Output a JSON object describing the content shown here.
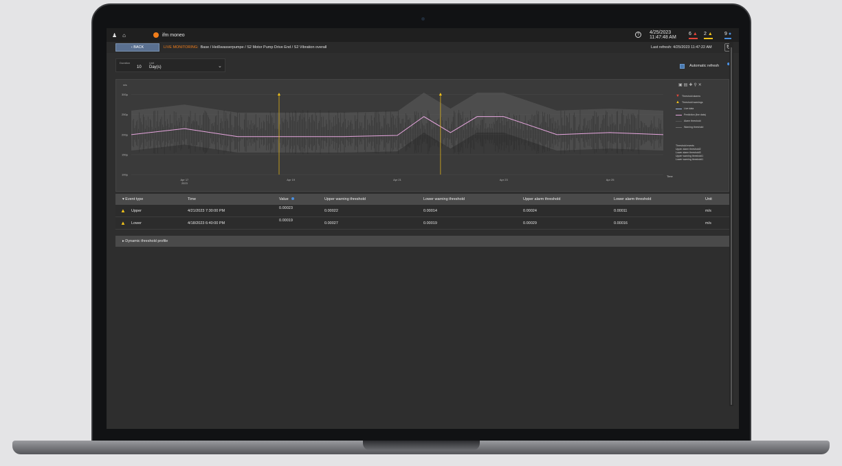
{
  "app": {
    "name": "ifm moneo"
  },
  "header": {
    "date": "4/25/2023",
    "time": "11:47:48 AM",
    "alarms_count": "6",
    "warnings_count": "2",
    "infos_count": "9"
  },
  "breadcrumb": {
    "back_label": "BACK",
    "live_label": "LIVE MONITORING:",
    "path": "Base / Heißwasserpumpe / S2 Motor Pump Drive End / S2 Vibration overall",
    "last_refresh": "Last refresh: 4/25/2023 11:47:22 AM"
  },
  "controls": {
    "duration_label": "Duration",
    "duration_value": "10",
    "unit_label": "Unit",
    "unit_value": "Day(s)",
    "auto_refresh_label": "Automatic refresh",
    "auto_refresh_checked": true
  },
  "chart_data": {
    "type": "line",
    "ylabel": "m/s",
    "xlabel": "Time",
    "ytick_labels": [
      "300µ",
      "250µ",
      "200µ",
      "150µ",
      "100µ"
    ],
    "y_ticks": [
      0.0003,
      0.00025,
      0.0002,
      0.00015,
      0.0001
    ],
    "ylim": [
      0.0001,
      0.00032
    ],
    "xtick_labels": [
      "Apr 17\n2023",
      "Apr 19",
      "Apr 21",
      "Apr 23",
      "Apr 25"
    ],
    "x_ticks": [
      "2023-04-17",
      "2023-04-19",
      "2023-04-21",
      "2023-04-23",
      "2023-04-25"
    ],
    "xlim": [
      "2023-04-16",
      "2023-04-26"
    ],
    "series": [
      {
        "name": "Live data",
        "color": "#9fb9e6"
      },
      {
        "name": "Prediction (live data)",
        "color": "#e8a7e0",
        "x": [
          "2023-04-16",
          "2023-04-17",
          "2023-04-18",
          "2023-04-19",
          "2023-04-20",
          "2023-04-21",
          "2023-04-21T12:00",
          "2023-04-22",
          "2023-04-22T12:00",
          "2023-04-23",
          "2023-04-24",
          "2023-04-25",
          "2023-04-26"
        ],
        "y": [
          0.0002,
          0.000215,
          0.000195,
          0.000195,
          0.000195,
          0.000198,
          0.000245,
          0.000205,
          0.000245,
          0.000245,
          0.0002,
          0.000205,
          0.0002
        ]
      },
      {
        "name": "Alarm threshold",
        "color": "#555555"
      },
      {
        "name": "Warning threshold",
        "color": "#6c6c6c"
      }
    ],
    "events": [
      {
        "type": "Threshold warnings",
        "date": "2023-04-18T18:40:00",
        "value": 0.00019
      },
      {
        "type": "Threshold warnings",
        "date": "2023-04-21T19:30:00",
        "value": 0.00023
      }
    ],
    "legend": {
      "position": "right",
      "items": [
        "Threshold alarms",
        "Threshold warnings",
        "Live data",
        "Prediction (live data)",
        "Alarm threshold",
        "Warning threshold"
      ],
      "threshold_events_title": "Threshold events",
      "threshold_events": [
        "Upper alarm threshold2",
        "Lower alarm threshold3",
        "Upper warning threshold1",
        "Lower warning threshold1"
      ]
    }
  },
  "table": {
    "headers": [
      "Event type",
      "Time",
      "Value",
      "Upper warning threshold",
      "Lower warning threshold",
      "Upper alarm threshold",
      "Lower alarm threshold",
      "Unit"
    ],
    "rows": [
      [
        "Upper",
        "4/21/2023 7:30:00 PM",
        "0.00023",
        "0.00022",
        "0.00014",
        "0.00024",
        "0.00011",
        "m/s"
      ],
      [
        "Lower",
        "4/18/2023 6:40:00 PM",
        "0.00019",
        "0.00027",
        "0.00019",
        "0.00029",
        "0.00016",
        "m/s"
      ]
    ]
  },
  "profile": {
    "label": "Dynamic threshold profile"
  }
}
